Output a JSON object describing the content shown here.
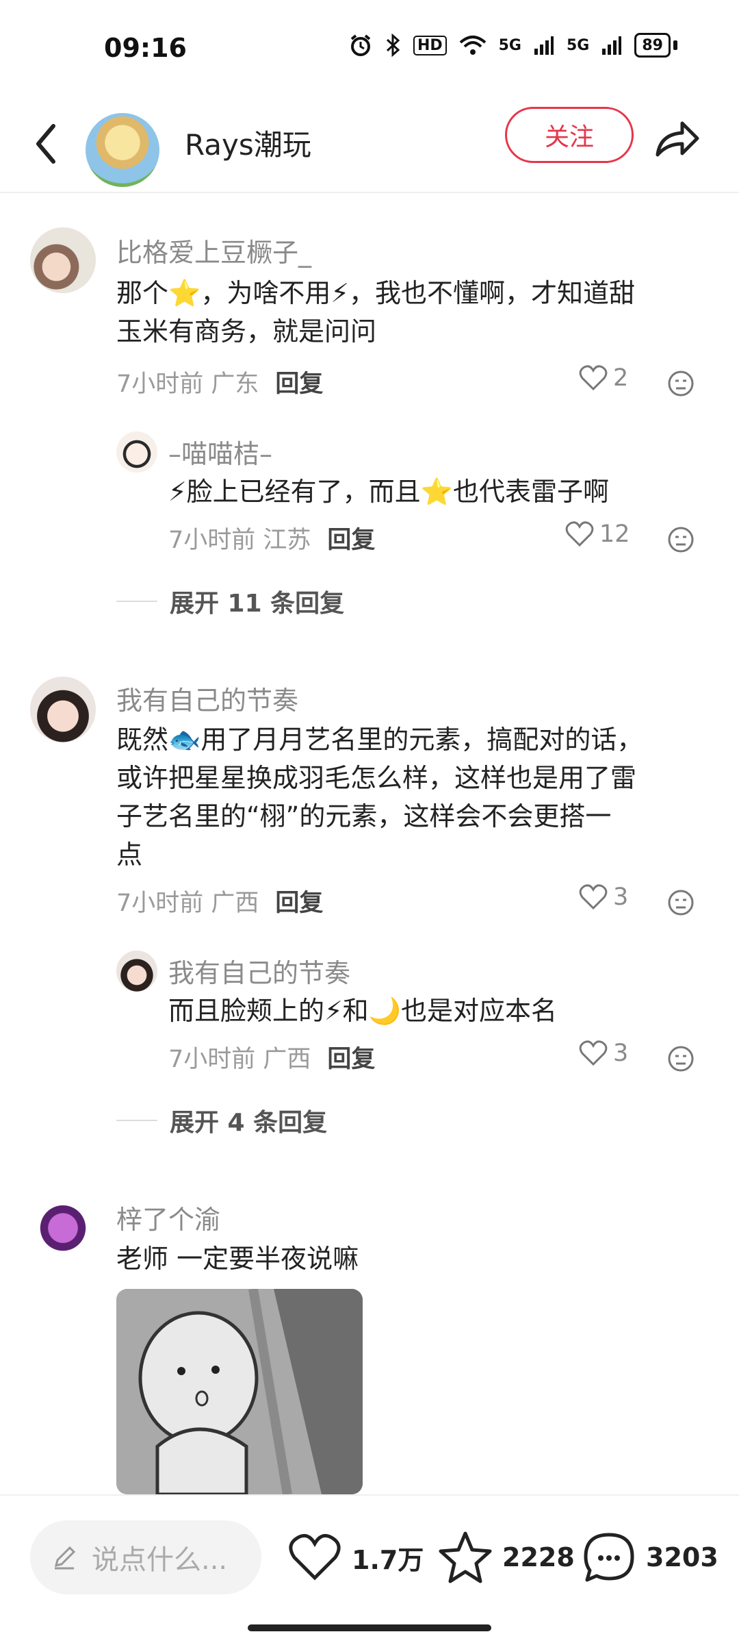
{
  "status": {
    "time": "09:16",
    "battery": "89",
    "net1": "5G",
    "net2": "5G",
    "hd": "HD"
  },
  "header": {
    "name": "Rays潮玩",
    "follow": "关注"
  },
  "comments": [
    {
      "user": "比格爱上豆橛子_",
      "lines": [
        "那个⭐，为啥不用⚡，我也不懂啊，才知道甜",
        "玉米有商务，就是问问"
      ],
      "meta": "7小时前 广东",
      "reply": "回复",
      "likes": "2",
      "sub": {
        "user": "–喵喵桔–",
        "text": "⚡脸上已经有了，而且⭐也代表雷子啊",
        "meta": "7小时前 江苏",
        "reply": "回复",
        "likes": "12"
      },
      "expand": "展开 11 条回复"
    },
    {
      "user": "我有自己的节奏",
      "lines": [
        "既然🐟用了月月艺名里的元素，搞配对的话，",
        "或许把星星换成羽毛怎么样，这样也是用了雷",
        "子艺名里的“栩”的元素，这样会不会更搭一",
        "点"
      ],
      "meta": "7小时前 广西",
      "reply": "回复",
      "likes": "3",
      "sub": {
        "user": "我有自己的节奏",
        "text": "而且脸颊上的⚡和🌙也是对应本名",
        "meta": "7小时前 广西",
        "reply": "回复",
        "likes": "3"
      },
      "expand": "展开 4 条回复"
    },
    {
      "user": "梓了个渝",
      "lines": [
        "老师 一定要半夜说嘛"
      ]
    }
  ],
  "bottom": {
    "placeholder": "说点什么...",
    "likes": "1.7万",
    "stars": "2228",
    "comments": "3203"
  }
}
